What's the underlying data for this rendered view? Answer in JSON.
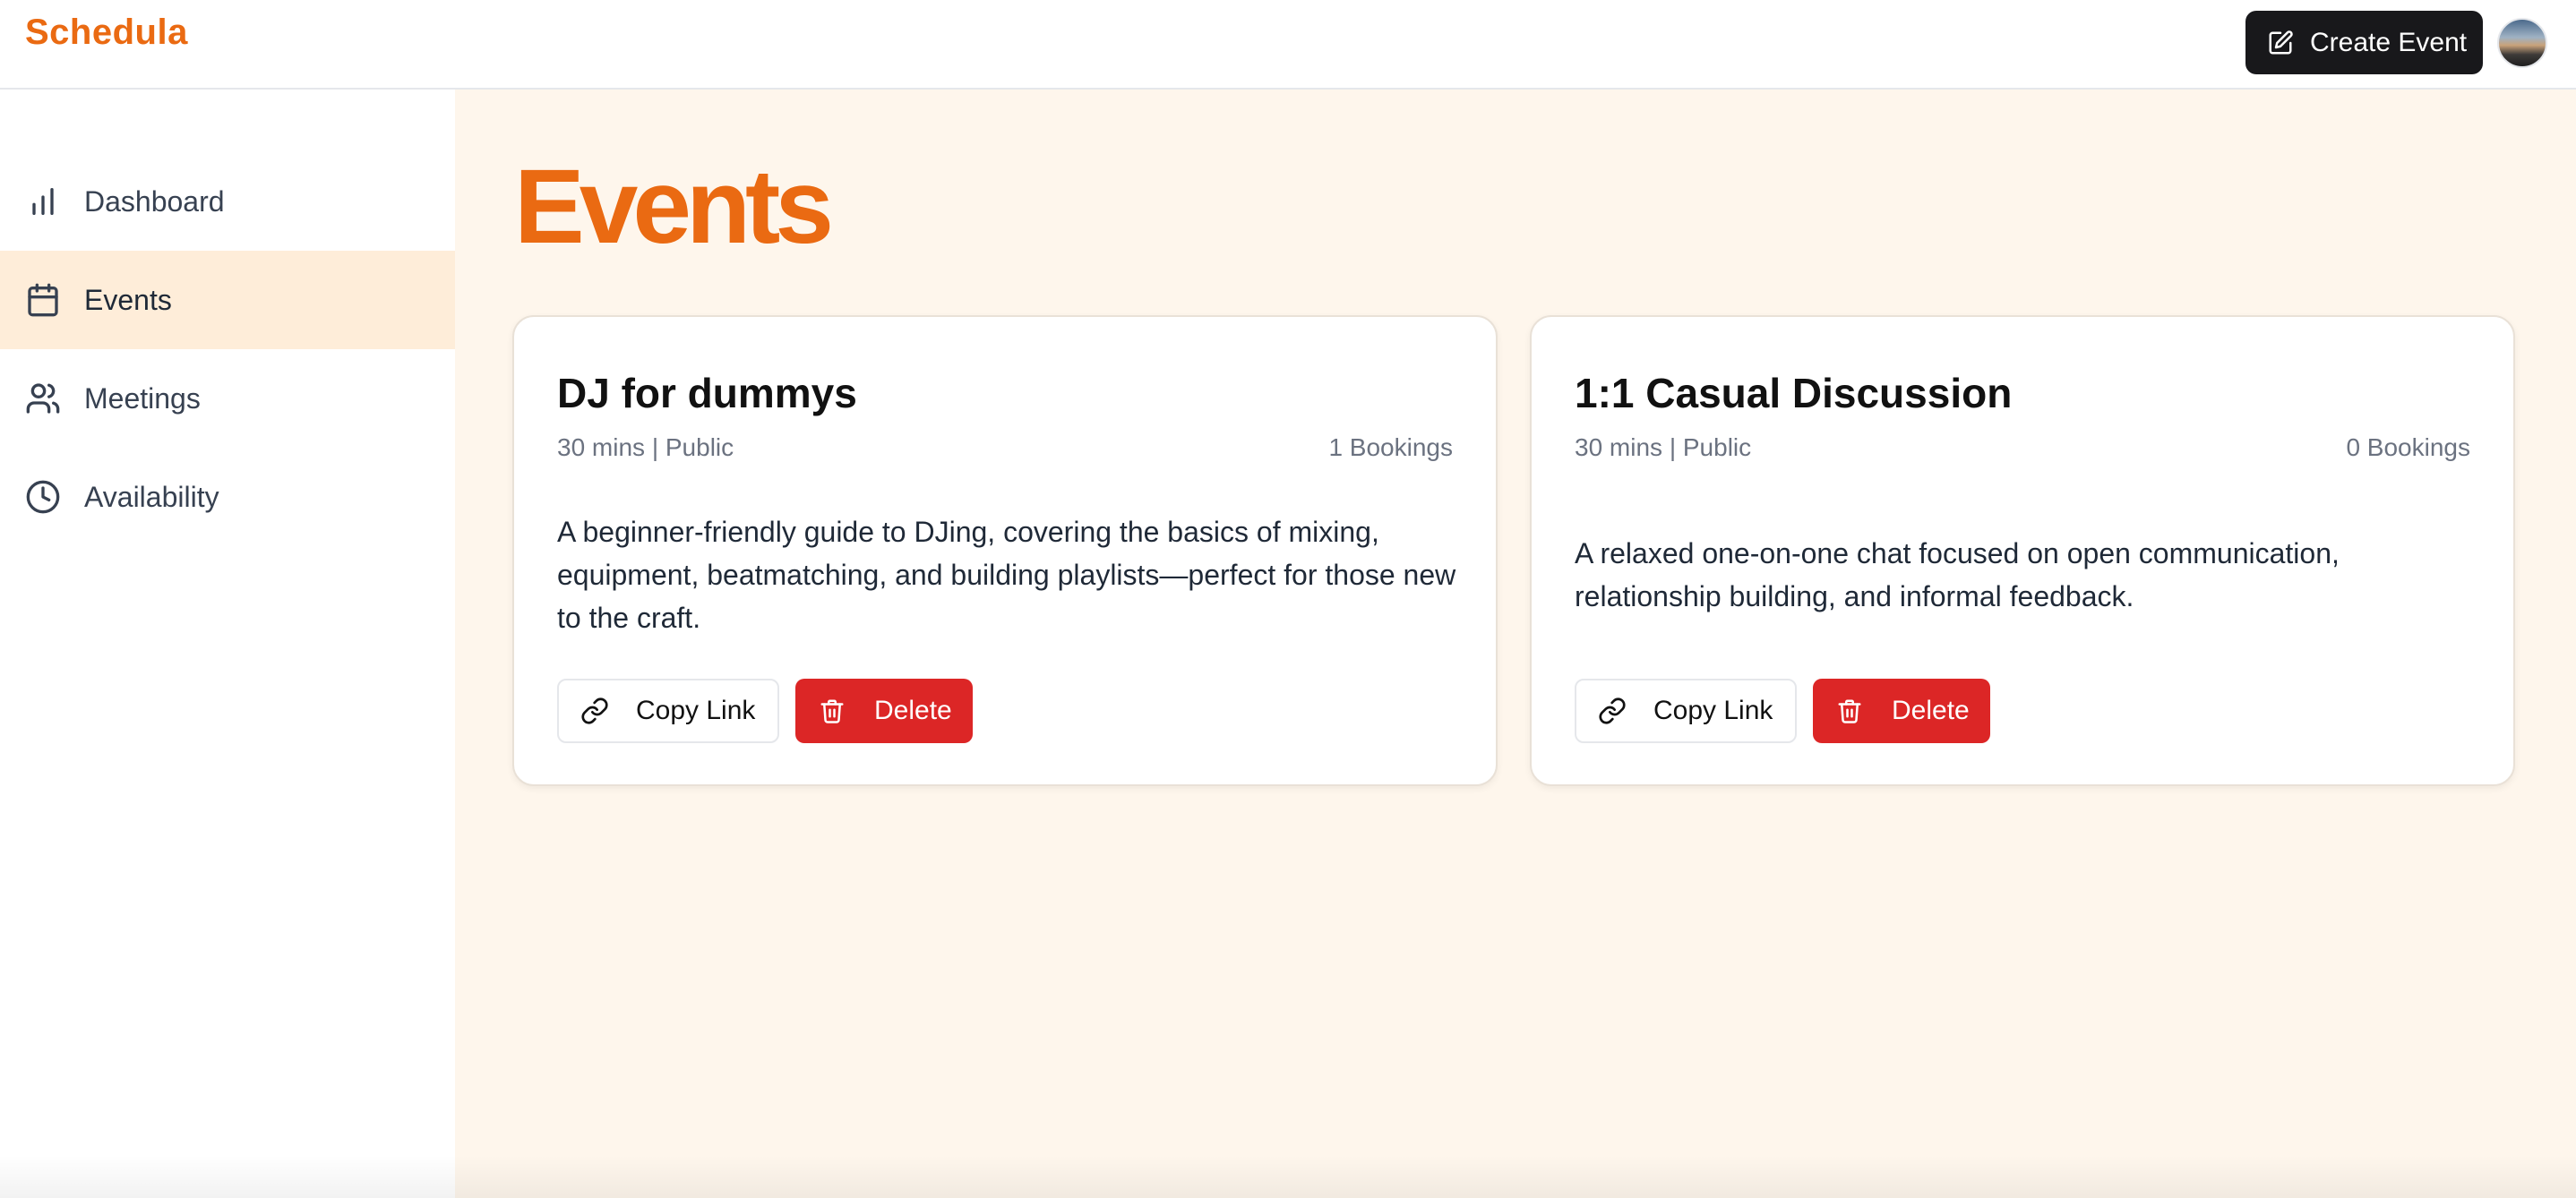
{
  "app": {
    "name": "Schedula"
  },
  "header": {
    "create_button_label": "Create Event",
    "create_icon": "edit-icon",
    "avatar_icon": "user-avatar"
  },
  "sidebar": {
    "items": [
      {
        "label": "Dashboard",
        "icon": "bar-chart-icon",
        "active": false
      },
      {
        "label": "Events",
        "icon": "calendar-icon",
        "active": true
      },
      {
        "label": "Meetings",
        "icon": "users-icon",
        "active": false
      },
      {
        "label": "Availability",
        "icon": "clock-icon",
        "active": false
      }
    ]
  },
  "main": {
    "title": "Events",
    "events": [
      {
        "title": "DJ for dummys",
        "meta": "30 mins | Public",
        "bookings": "1 Bookings",
        "description": "A beginner-friendly guide to DJing, covering the basics of mixing, equipment, beatmatching, and building playlists—perfect for those new to the craft.",
        "copy_label": "Copy Link",
        "delete_label": "Delete"
      },
      {
        "title": "1:1 Casual Discussion",
        "meta": "30 mins | Public",
        "bookings": "0 Bookings",
        "description": "A relaxed one-on-one chat focused on open communication, relationship building, and informal feedback.",
        "copy_label": "Copy Link",
        "delete_label": "Delete"
      }
    ]
  },
  "colors": {
    "brand": "#ea6a12",
    "active_nav_bg": "#feedd9",
    "main_bg": "#fef6ec",
    "delete": "#dc2626",
    "dark_button": "#18181b"
  }
}
